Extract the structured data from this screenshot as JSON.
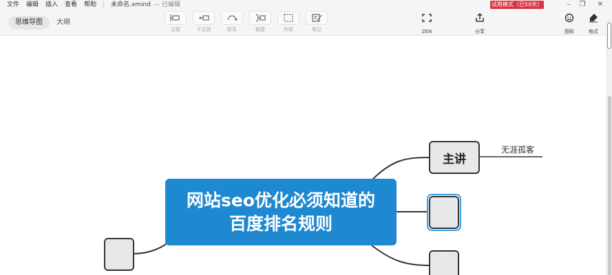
{
  "menu": {
    "items": [
      "文件",
      "编辑",
      "插入",
      "查看",
      "帮助"
    ],
    "doc_title": "未命名.xmind",
    "doc_status": "— 已编辑"
  },
  "trial_badge": "试用模式（已59天）",
  "view_tabs": [
    {
      "label": "思维导图",
      "active": true
    },
    {
      "label": "大纲",
      "active": false
    }
  ],
  "tools": [
    {
      "label": "主题",
      "icon": "topic-icon"
    },
    {
      "label": "子主题",
      "icon": "subtopic-icon"
    },
    {
      "label": "联系",
      "icon": "relationship-icon"
    },
    {
      "label": "概要",
      "icon": "summary-icon"
    },
    {
      "label": "外框",
      "icon": "boundary-icon"
    },
    {
      "label": "笔记",
      "icon": "note-icon"
    }
  ],
  "right_tools": [
    {
      "label": "ZEN",
      "icon": "zen-icon"
    },
    {
      "label": "分享",
      "icon": "share-icon"
    },
    {
      "label": "图标",
      "icon": "emoji-icon"
    },
    {
      "label": "格式",
      "icon": "format-icon"
    }
  ],
  "mindmap": {
    "central_topic": [
      "网站seo优化必须知道的",
      "百度排名规则"
    ],
    "subtopic_main": "主讲",
    "floating_label": "无涯孤客"
  },
  "colors": {
    "central_fill": "#1e88d0",
    "trial_badge": "#d9333f",
    "selection": "#37a0ea"
  }
}
